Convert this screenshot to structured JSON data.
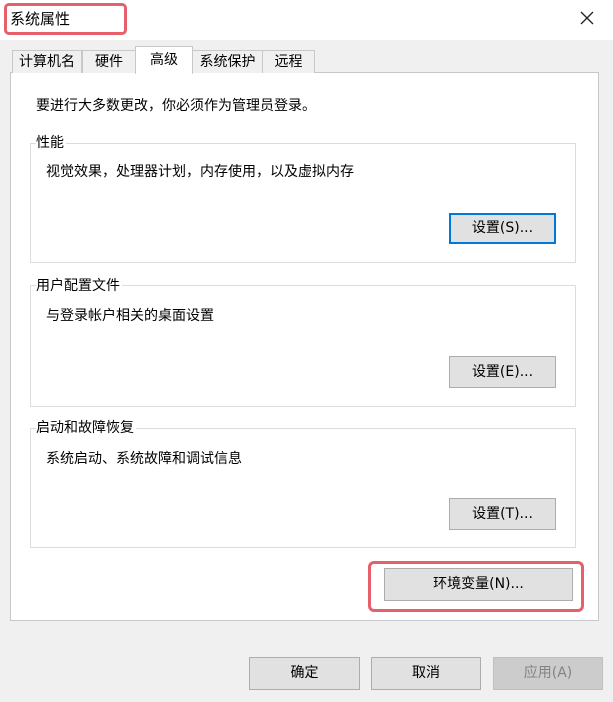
{
  "window": {
    "title": "系统属性",
    "close_icon": "close-icon",
    "highlight_color": "#e5606a"
  },
  "tabs": [
    {
      "label": "计算机名",
      "active": false
    },
    {
      "label": "硬件",
      "active": false
    },
    {
      "label": "高级",
      "active": true
    },
    {
      "label": "系统保护",
      "active": false
    },
    {
      "label": "远程",
      "active": false
    }
  ],
  "advanced": {
    "admin_notice": "要进行大多数更改，你必须作为管理员登录。",
    "performance": {
      "title": "性能",
      "description": "视觉效果，处理器计划，内存使用，以及虚拟内存",
      "button": "设置(S)..."
    },
    "user_profiles": {
      "title": "用户配置文件",
      "description": "与登录帐户相关的桌面设置",
      "button": "设置(E)..."
    },
    "startup_recovery": {
      "title": "启动和故障恢复",
      "description": "系统启动、系统故障和调试信息",
      "button": "设置(T)..."
    },
    "env_button": "环境变量(N)..."
  },
  "footer": {
    "ok": "确定",
    "cancel": "取消",
    "apply": "应用(A)"
  }
}
